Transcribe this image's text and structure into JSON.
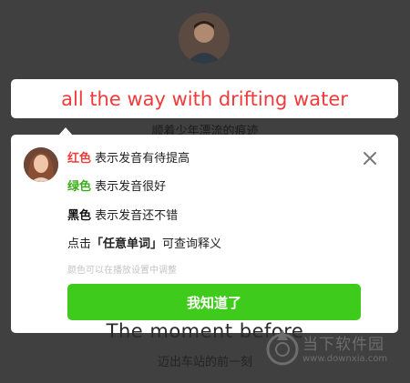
{
  "sentence": {
    "text": "all the way with drifting water"
  },
  "background": {
    "subtitle": "顺着少年漂流的痕迹",
    "big_line": "The moment before",
    "small_line": "迈出车站的前一刻"
  },
  "tip_card": {
    "lines": [
      {
        "keyword": "红色",
        "keyword_color": "#f03b3b",
        "text": " 表示发音有待提高"
      },
      {
        "keyword": "绿色",
        "keyword_color": "#3aae1a",
        "text": " 表示发音很好"
      },
      {
        "keyword": "黑色",
        "keyword_color": "#111111",
        "text": " 表示发音还不错"
      }
    ],
    "tap_prefix": "点击",
    "tap_keyword": "「任意单词」",
    "tap_suffix": "可查询释义",
    "hint": "颜色可以在播放设置中调整",
    "confirm_label": "我知道了",
    "close_icon": "close-icon"
  },
  "watermark": {
    "name": "当下软件园",
    "url": "www.downxia.com"
  },
  "colors": {
    "accent_green": "#3ecb1c",
    "sentence_red": "#f03b3b"
  }
}
